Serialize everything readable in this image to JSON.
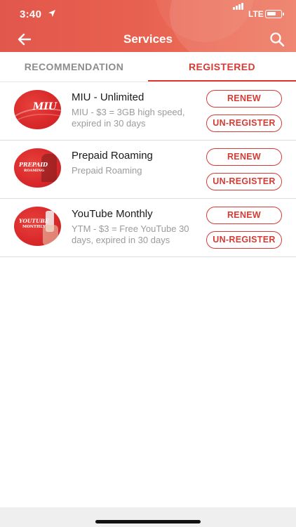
{
  "status": {
    "time": "3:40",
    "network": "LTE"
  },
  "nav": {
    "title": "Services"
  },
  "tabs": [
    {
      "label": "RECOMMENDATION",
      "active": false
    },
    {
      "label": "REGISTERED",
      "active": true
    }
  ],
  "services": [
    {
      "name": "MIU - Unlimited",
      "description": "MIU - $3 = 3GB high speed, expired in 30 days",
      "thumb_text": "MIU",
      "renew_label": "RENEW",
      "unregister_label": "UN-REGISTER"
    },
    {
      "name": "Prepaid Roaming",
      "description": "Prepaid Roaming",
      "thumb_text": "PREPAID",
      "thumb_subtext": "ROAMING",
      "renew_label": "RENEW",
      "unregister_label": "UN-REGISTER"
    },
    {
      "name": "YouTube Monthly",
      "description": "YTM - $3 = Free YouTube 30 days, expired in 30 days",
      "thumb_text": "YOUTUBE",
      "thumb_subtext": "MONTHLY",
      "renew_label": "RENEW",
      "unregister_label": "UN-REGISTER"
    }
  ],
  "colors": {
    "accent": "#d63b34",
    "header_start": "#e2574c",
    "header_end": "#ee7a62"
  },
  "icons": {
    "back": "arrow-left-icon",
    "search": "search-icon",
    "location": "location-arrow-icon"
  }
}
